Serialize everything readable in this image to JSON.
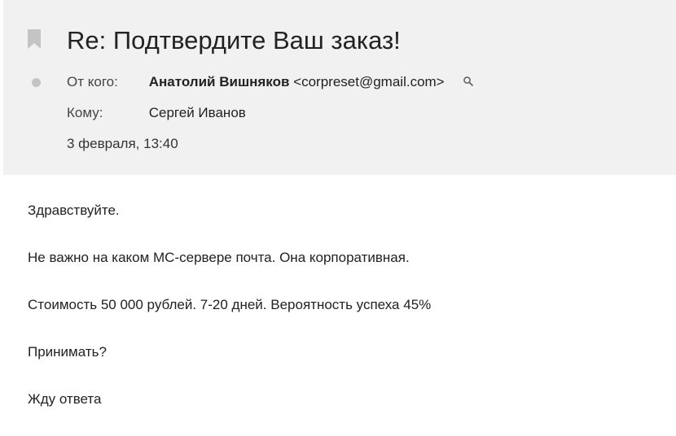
{
  "email": {
    "subject": "Re: Подтвердите Ваш заказ!",
    "from_label": "От кого:",
    "sender_name": "Анатолий Вишняков",
    "sender_email": "<corpreset@gmail.com>",
    "to_label": "Кому:",
    "recipient": "Сергей Иванов",
    "date": "3 февраля, 13:40",
    "body": [
      "Здравствуйте.",
      "Не важно на каком МС-сервере почта. Она корпоративная.",
      "Стоимость 50 000 рублей. 7-20  дней. Вероятность успеха 45%",
      "Принимать?",
      "Жду ответа"
    ]
  },
  "colors": {
    "header_background": "#f1f1f1",
    "icon_gray": "#c4c4c4"
  },
  "icons": [
    "bookmark-icon",
    "dot-icon",
    "search-icon"
  ]
}
